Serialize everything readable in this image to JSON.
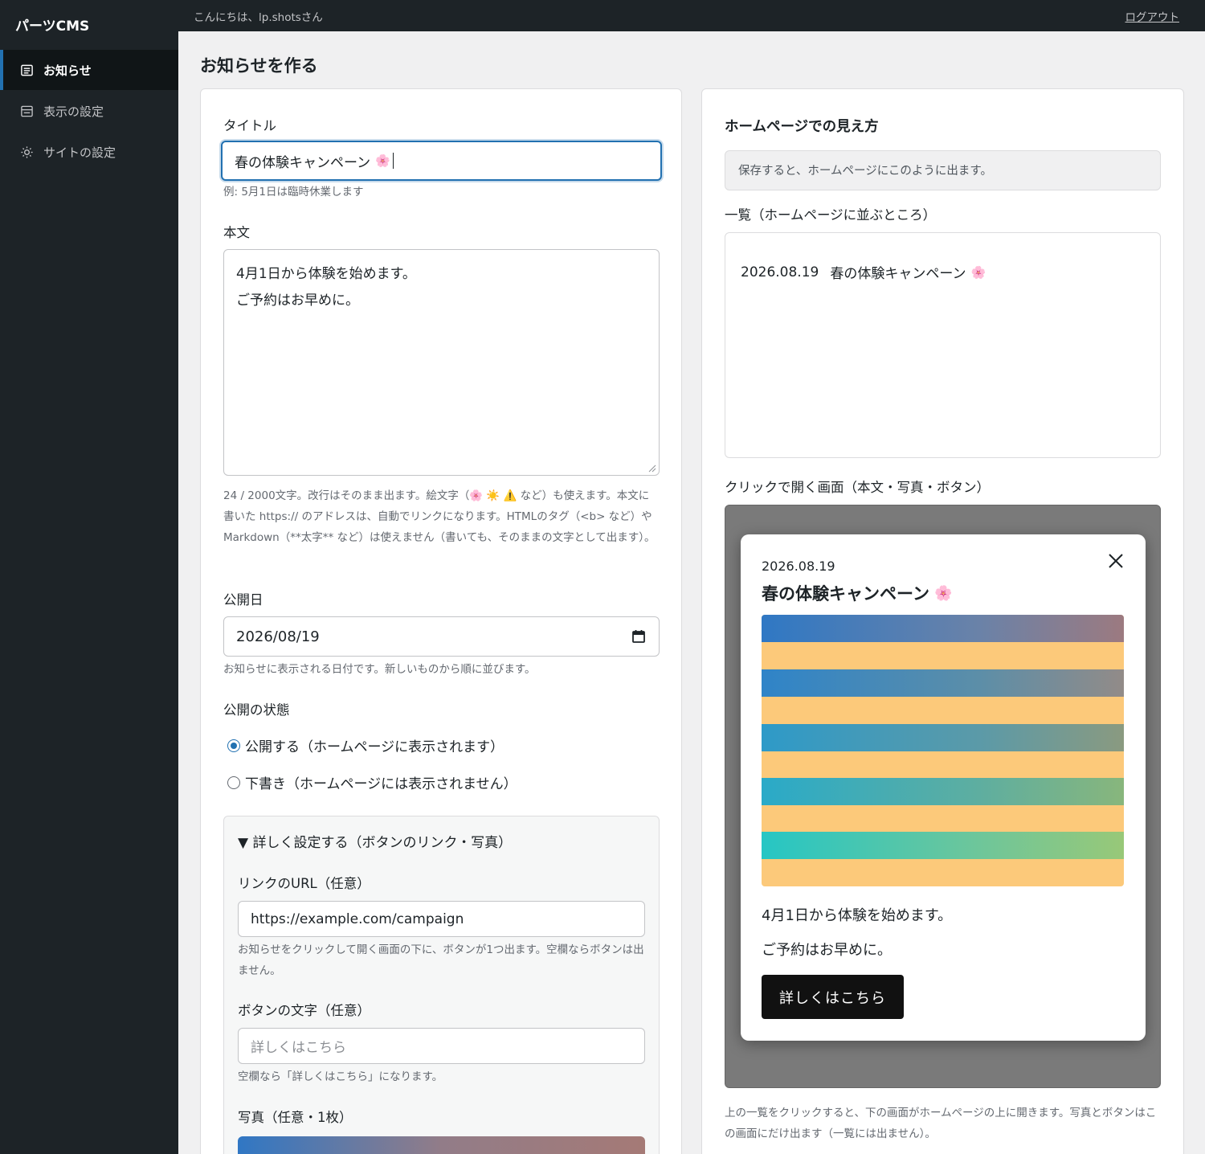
{
  "sidebar": {
    "brand": "パーツCMS",
    "items": [
      {
        "label": "お知らせ",
        "icon": "list-icon",
        "active": true
      },
      {
        "label": "表示の設定",
        "icon": "layout-icon",
        "active": false
      },
      {
        "label": "サイトの設定",
        "icon": "sun-gear-icon",
        "active": false
      }
    ]
  },
  "topbar": {
    "greeting": "こんにちは、lp.shotsさん",
    "logout": "ログアウト"
  },
  "page": {
    "title": "お知らせを作る"
  },
  "form": {
    "title_label": "タイトル",
    "title_value": "春の体験キャンペーン",
    "title_emoji": "🌸",
    "title_hint": "例: 5月1日は臨時休業します",
    "body_label": "本文",
    "body_line1": "4月1日から体験を始めます。",
    "body_line2": "ご予約はお早めに。",
    "body_hint_1": "24 / 2000文字。改行はそのまま出ます。絵文字（",
    "body_hint_emojis": "🌸 ☀️ ⚠️",
    "body_hint_2": " など）も使えます。本文に書いた https:// のアドレスは、自動でリンクになります。HTMLのタグ（<b> など）や Markdown（**太字** など）は使えません（書いても、そのままの文字として出ます）。",
    "date_label": "公開日",
    "date_value": "2026/08/19",
    "date_hint": "お知らせに表示される日付です。新しいものから順に並びます。",
    "status_label": "公開の状態",
    "status_options": [
      {
        "label": "公開する（ホームページに表示されます）",
        "checked": true
      },
      {
        "label": "下書き（ホームページには表示されません）",
        "checked": false
      }
    ],
    "details": {
      "summary": "▼ 詳しく設定する（ボタンのリンク・写真）",
      "url_label": "リンクのURL（任意）",
      "url_value": "https://example.com/campaign",
      "url_hint": "お知らせをクリックして開く画面の下に、ボタンが1つ出ます。空欄ならボタンは出ません。",
      "button_label": "ボタンの文字（任意）",
      "button_placeholder": "詳しくはこちら",
      "button_hint": "空欄なら「詳しくはこちら」になります。",
      "photo_label": "写真（任意・1枚）"
    }
  },
  "preview": {
    "title": "ホームページでの見え方",
    "notice": "保存すると、ホームページにこのように出ます。",
    "list_label": "一覧（ホームページに並ぶところ）",
    "list_item": {
      "date": "2026.08.19",
      "title": "春の体験キャンペーン",
      "emoji": "🌸"
    },
    "modal_label": "クリックで開く画面（本文・写真・ボタン）",
    "modal": {
      "date": "2026.08.19",
      "title": "春の体験キャンペーン",
      "emoji": "🌸",
      "body_line1": "4月1日から体験を始めます。",
      "body_line2": "ご予約はお早めに。",
      "cta": "詳しくはこちら"
    },
    "footer_note": "上の一覧をクリックすると、下の画面がホームページの上に開きます。写真とボタンはこの画面にだけ出ます（一覧には出ません）。"
  },
  "colors": {
    "accent": "#2271b1",
    "sidebar_bg": "#1d2327",
    "stripe_yellow": "#fcc97a"
  }
}
